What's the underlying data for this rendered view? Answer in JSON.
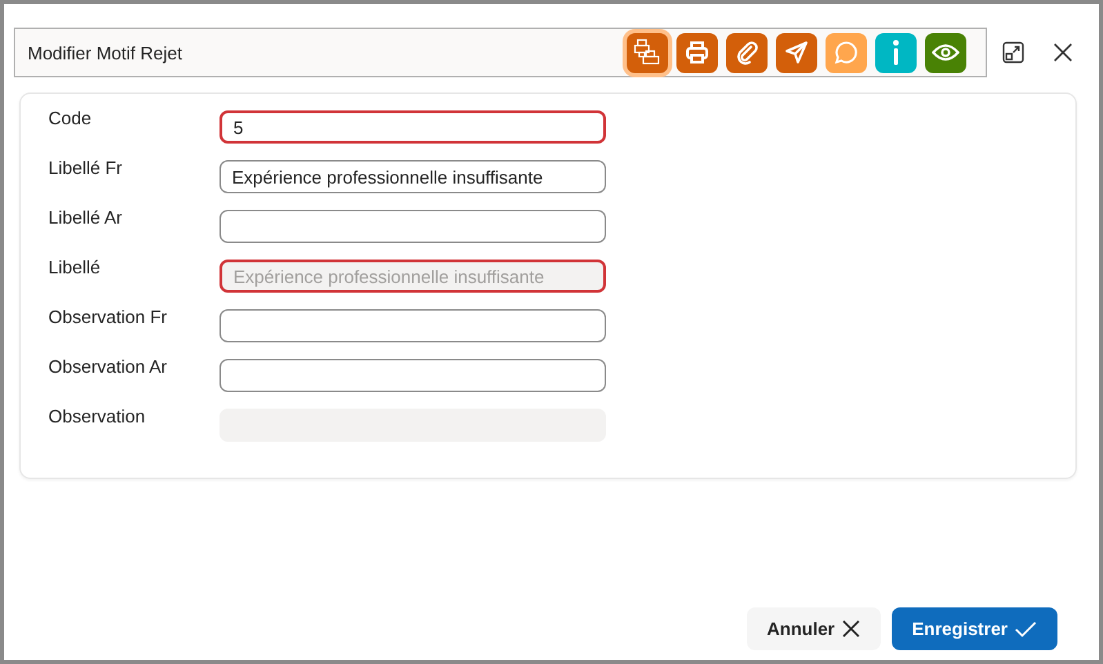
{
  "window": {
    "title": "Modifier Motif Rejet"
  },
  "toolbar": [
    {
      "kind": "printers",
      "color": "#d35f0a",
      "selected": true
    },
    {
      "kind": "print",
      "color": "#d35f0a",
      "selected": false
    },
    {
      "kind": "attach",
      "color": "#d35f0a",
      "selected": false
    },
    {
      "kind": "send",
      "color": "#d35f0a",
      "selected": false
    },
    {
      "kind": "comment",
      "color": "#ffa64d",
      "selected": false
    },
    {
      "kind": "info",
      "color": "#00b7c3",
      "selected": false
    },
    {
      "kind": "view",
      "color": "#498205",
      "selected": false
    }
  ],
  "fields": [
    {
      "label": "Code",
      "value": "5",
      "invalid": true,
      "disabled": false
    },
    {
      "label": "Libellé Fr",
      "value": "Expérience professionnelle insuffisante",
      "invalid": false,
      "disabled": false
    },
    {
      "label": "Libellé Ar",
      "invalid": false,
      "disabled": false
    },
    {
      "label": "Libellé",
      "value": "Expérience professionnelle insuffisante",
      "invalid": true,
      "disabled": true
    },
    {
      "label": "Observation Fr",
      "invalid": false,
      "disabled": false
    },
    {
      "label": "Observation Ar",
      "invalid": false,
      "disabled": false
    },
    {
      "label": "Observation",
      "invalid": false,
      "disabled": true
    }
  ],
  "buttons": [
    {
      "label": "Annuler",
      "kind": "cancel"
    },
    {
      "label": "Enregistrer",
      "kind": "save"
    }
  ]
}
